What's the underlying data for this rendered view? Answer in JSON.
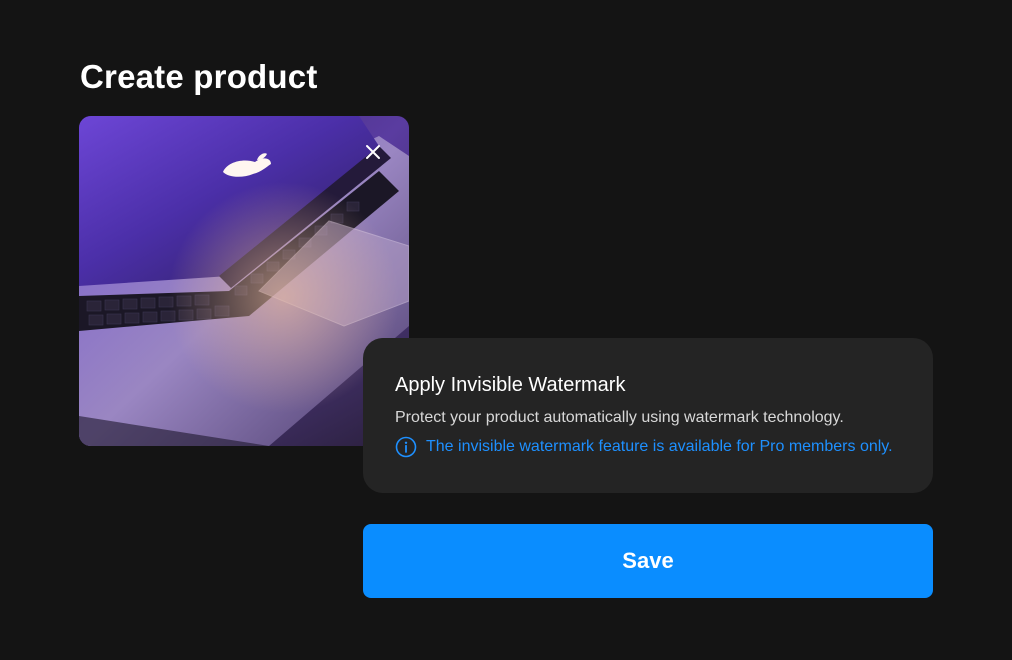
{
  "page": {
    "title": "Create product"
  },
  "product_image": {
    "description_icon": "laptop-photo",
    "remove_icon": "close-icon"
  },
  "watermark": {
    "title": "Apply Invisible Watermark",
    "description": "Protect your product automatically using watermark technology.",
    "note_icon": "info-icon",
    "note": "The invisible watermark feature is available for Pro members only."
  },
  "actions": {
    "save_label": "Save"
  },
  "colors": {
    "background": "#141414",
    "card": "#242424",
    "accent": "#0a8dff",
    "note_text": "#1e90ff"
  }
}
